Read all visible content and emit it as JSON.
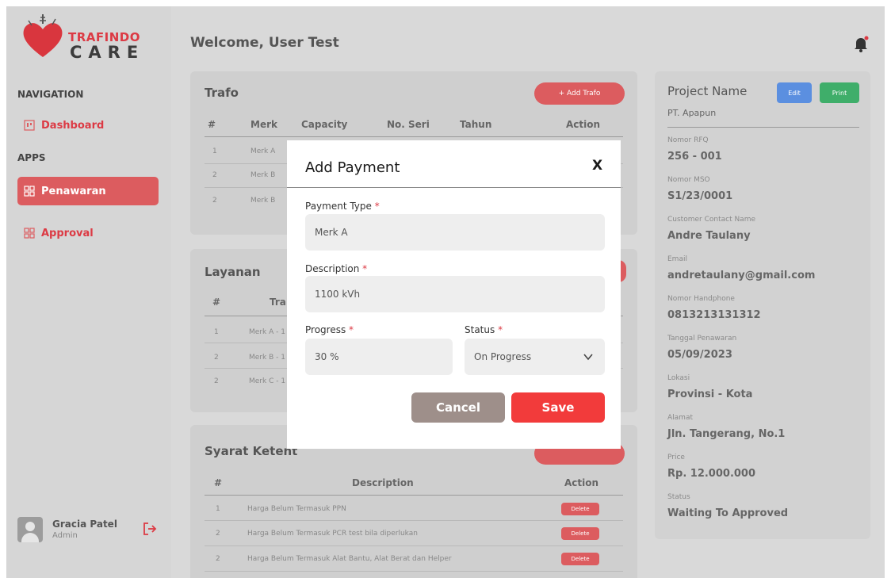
{
  "sidebar": {
    "logo_top": "TRAFINDO",
    "logo_bottom": "CARE",
    "nav_label": "NAVIGATION",
    "apps_label": "APPS",
    "items": [
      {
        "label": "Dashboard"
      },
      {
        "label": "Penawaran"
      },
      {
        "label": "Approval"
      }
    ],
    "user": {
      "name": "Gracia Patel",
      "role": "Admin"
    }
  },
  "header": {
    "welcome": "Welcome, User Test"
  },
  "trafo": {
    "title": "Trafo",
    "add_button": "+ Add Trafo",
    "columns": [
      "#",
      "Merk",
      "Capacity",
      "No. Seri",
      "Tahun",
      "Action"
    ],
    "rows": [
      {
        "no": "1",
        "merk": "Merk A"
      },
      {
        "no": "2",
        "merk": "Merk B"
      },
      {
        "no": "2",
        "merk": "Merk B"
      }
    ]
  },
  "layanan": {
    "title": "Layanan",
    "columns": [
      "#",
      "Tra"
    ],
    "rows": [
      {
        "no": "1",
        "text": "Merk A - 1"
      },
      {
        "no": "2",
        "text": "Merk B - 1"
      },
      {
        "no": "2",
        "text": "Merk C - 1"
      }
    ]
  },
  "syarat": {
    "title": "Syarat Ketent",
    "columns": [
      "#",
      "Description",
      "Action"
    ],
    "rows": [
      {
        "no": "1",
        "desc": "Harga Belum Termasuk PPN",
        "action": "Delete"
      },
      {
        "no": "2",
        "desc": "Harga Belum Termasuk PCR test bila diperlukan",
        "action": "Delete"
      },
      {
        "no": "2",
        "desc": "Harga Belum Termasuk Alat Bantu, Alat Berat dan Helper",
        "action": "Delete"
      }
    ]
  },
  "project": {
    "title": "Project Name",
    "subtitle": "PT. Apapun",
    "edit_button": "Edit",
    "print_button": "Print",
    "fields": [
      {
        "label": "Nomor RFQ",
        "value": "256 - 001"
      },
      {
        "label": "Nomor MSO",
        "value": "S1/23/0001"
      },
      {
        "label": "Customer Contact Name",
        "value": "Andre Taulany"
      },
      {
        "label": "Email",
        "value": "andretaulany@gmail.com"
      },
      {
        "label": "Nomor Handphone",
        "value": "0813213131312"
      },
      {
        "label": "Tanggal Penawaran",
        "value": "05/09/2023"
      },
      {
        "label": "Lokasi",
        "value": "Provinsi - Kota"
      },
      {
        "label": "Alamat",
        "value": "Jln. Tangerang, No.1"
      },
      {
        "label": "Price",
        "value": "Rp. 12.000.000"
      },
      {
        "label": "Status",
        "value": "Waiting To Approved"
      }
    ]
  },
  "modal": {
    "title": "Add Payment",
    "close": "X",
    "payment_type_label": "Payment Type",
    "payment_type_value": "Merk A",
    "description_label": "Description",
    "description_value": "1100 kVh",
    "progress_label": "Progress",
    "progress_value": "30 %",
    "status_label": "Status",
    "status_value": "On Progress",
    "required_mark": "*",
    "cancel": "Cancel",
    "save": "Save"
  },
  "colors": {
    "accent": "#dc3a44",
    "save": "#f23b3b",
    "cancel": "#9e8f8a",
    "edit": "#5b8fe0",
    "print": "#3fae6a"
  }
}
